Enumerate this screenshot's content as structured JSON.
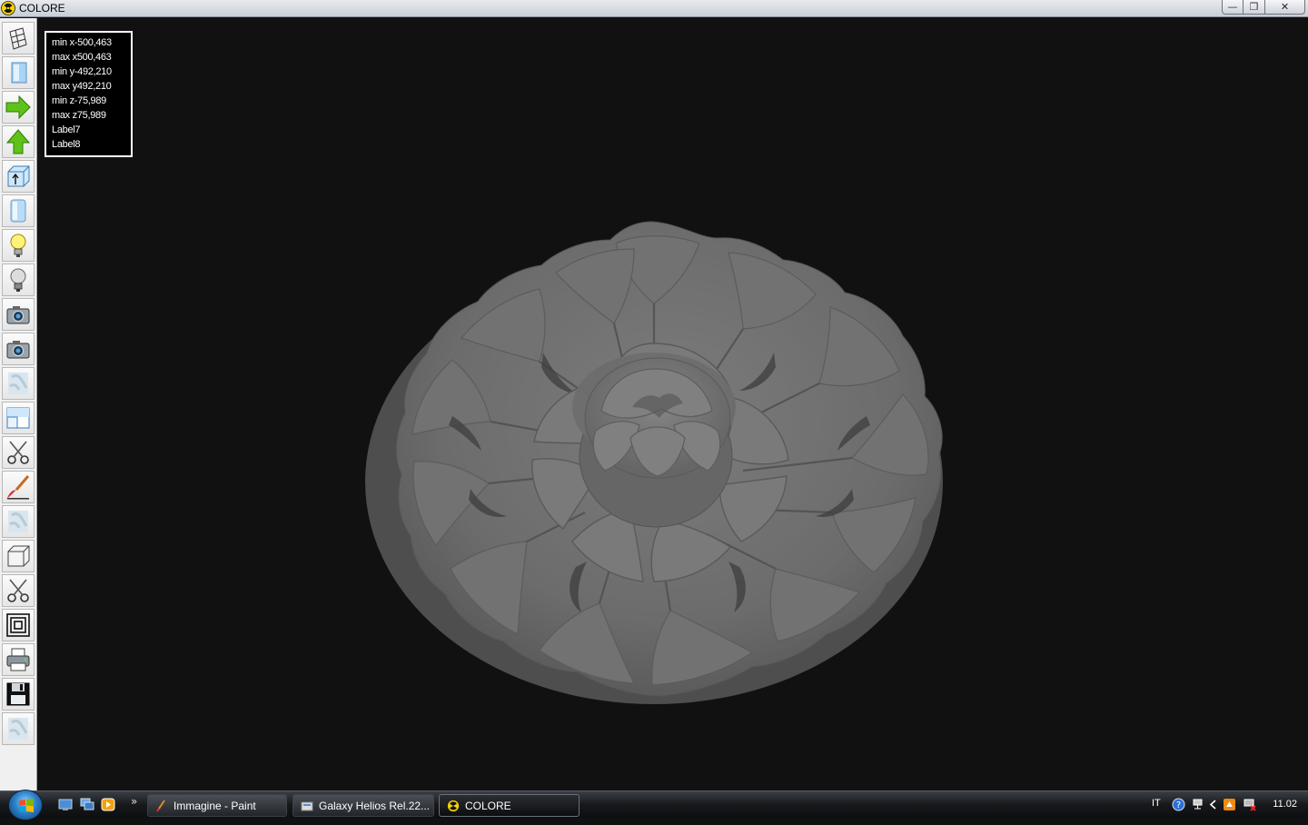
{
  "window": {
    "title": "COLORE",
    "minimize_glyph": "—",
    "maximize_glyph": "❐",
    "close_glyph": "✕"
  },
  "toolbar": {
    "tools": [
      {
        "icon": "wireframe-box-icon"
      },
      {
        "icon": "blue-panel-icon"
      },
      {
        "icon": "arrow-right-green-icon"
      },
      {
        "icon": "arrow-up-green-icon"
      },
      {
        "icon": "box-arrow-up-icon"
      },
      {
        "icon": "cylinder-icon"
      },
      {
        "icon": "lightbulb-on-icon"
      },
      {
        "icon": "lightbulb-off-icon"
      },
      {
        "icon": "camera-icon"
      },
      {
        "icon": "camera-icon"
      },
      {
        "icon": "texture-icon"
      },
      {
        "icon": "window-icon"
      },
      {
        "icon": "scissors-icon"
      },
      {
        "icon": "paintbrush-icon"
      },
      {
        "icon": "texture-icon"
      },
      {
        "icon": "cube-icon"
      },
      {
        "icon": "scissors-icon"
      },
      {
        "icon": "concentric-squares-icon"
      },
      {
        "icon": "printer-icon"
      },
      {
        "icon": "floppy-disk-icon"
      },
      {
        "icon": "texture-icon"
      }
    ]
  },
  "info_panel": {
    "lines": [
      "min x-500,463",
      "max x500,463",
      "min y-492,210",
      "max y492,210",
      "min z-75,989",
      "max z75,989",
      "Label7",
      "Label8"
    ]
  },
  "taskbar": {
    "more_glyph": "»",
    "tasks": [
      {
        "label": "Immagine - Paint"
      },
      {
        "label": "Galaxy Helios  Rel.22..."
      },
      {
        "label": "COLORE"
      }
    ],
    "tray": {
      "language": "IT",
      "clock": "11.02"
    }
  },
  "colors": {
    "viewport_bg": "#111111",
    "model_gray": "#6e6e6e"
  }
}
